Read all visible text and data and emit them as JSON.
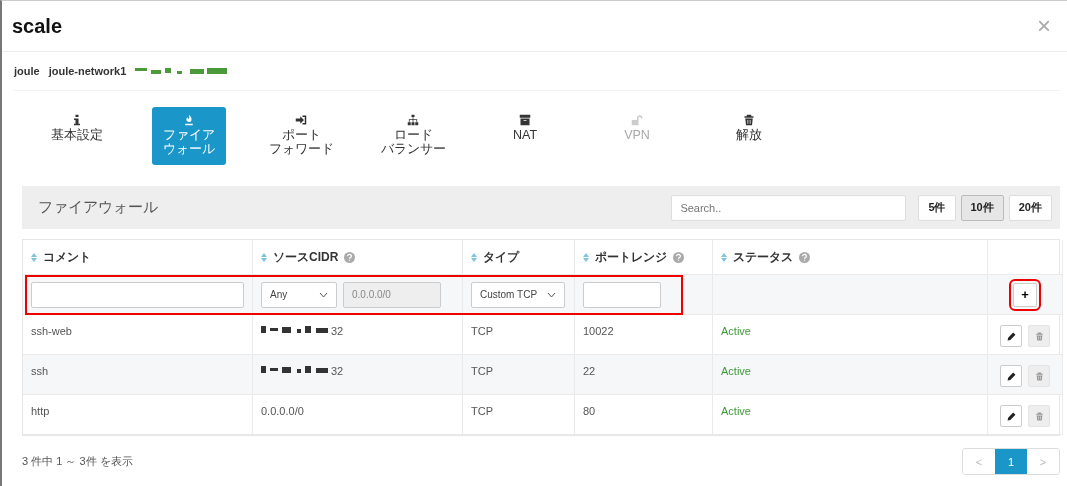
{
  "window": {
    "title": "scale",
    "close": "×"
  },
  "breadcrumb": [
    "joule",
    "joule-network1"
  ],
  "tabs": [
    {
      "label_lines": [
        "基本設定"
      ],
      "kind": "info",
      "selected": false,
      "disabled": false
    },
    {
      "label_lines": [
        "ファイア",
        "ウォール"
      ],
      "kind": "firewall",
      "selected": true,
      "disabled": false
    },
    {
      "label_lines": [
        "ポート",
        "フォワード"
      ],
      "kind": "forward",
      "selected": false,
      "disabled": false
    },
    {
      "label_lines": [
        "ロード",
        "バランサー"
      ],
      "kind": "balancer",
      "selected": false,
      "disabled": false
    },
    {
      "label_lines": [
        "NAT"
      ],
      "kind": "nat",
      "selected": false,
      "disabled": false
    },
    {
      "label_lines": [
        "VPN"
      ],
      "kind": "vpn",
      "selected": false,
      "disabled": true
    },
    {
      "label_lines": [
        "解放"
      ],
      "kind": "release",
      "selected": false,
      "disabled": false
    }
  ],
  "panel": {
    "title": "ファイアウォール",
    "search": {
      "placeholder": "Search.."
    },
    "page_sizes": [
      {
        "label": "5件",
        "selected": false
      },
      {
        "label": "10件",
        "selected": true
      },
      {
        "label": "20件",
        "selected": false
      }
    ]
  },
  "table": {
    "columns": [
      {
        "label": "コメント",
        "help": false
      },
      {
        "label": "ソースCIDR",
        "help": true
      },
      {
        "label": "タイプ",
        "help": false
      },
      {
        "label": "ポートレンジ",
        "help": true
      },
      {
        "label": "ステータス",
        "help": true
      }
    ],
    "new_row": {
      "source": "Any",
      "cidr": "0.0.0.0/0",
      "type": "Custom TCP",
      "add": "+",
      "highlighted": true
    },
    "rows": [
      {
        "comment": "ssh-web",
        "cidr": "32",
        "cidr_redacted": true,
        "type": "TCP",
        "port": "10022",
        "status": "Active"
      },
      {
        "comment": "ssh",
        "cidr": "32",
        "cidr_redacted": true,
        "type": "TCP",
        "port": "22",
        "status": "Active"
      },
      {
        "comment": "http",
        "cidr": "0.0.0.0/0",
        "cidr_redacted": false,
        "type": "TCP",
        "port": "80",
        "status": "Active"
      }
    ]
  },
  "footer": {
    "summary": "3 件中 1 ～ 3件 を表示",
    "prev": "<",
    "pages": [
      {
        "label": "1",
        "selected": true
      }
    ],
    "next": ">"
  }
}
